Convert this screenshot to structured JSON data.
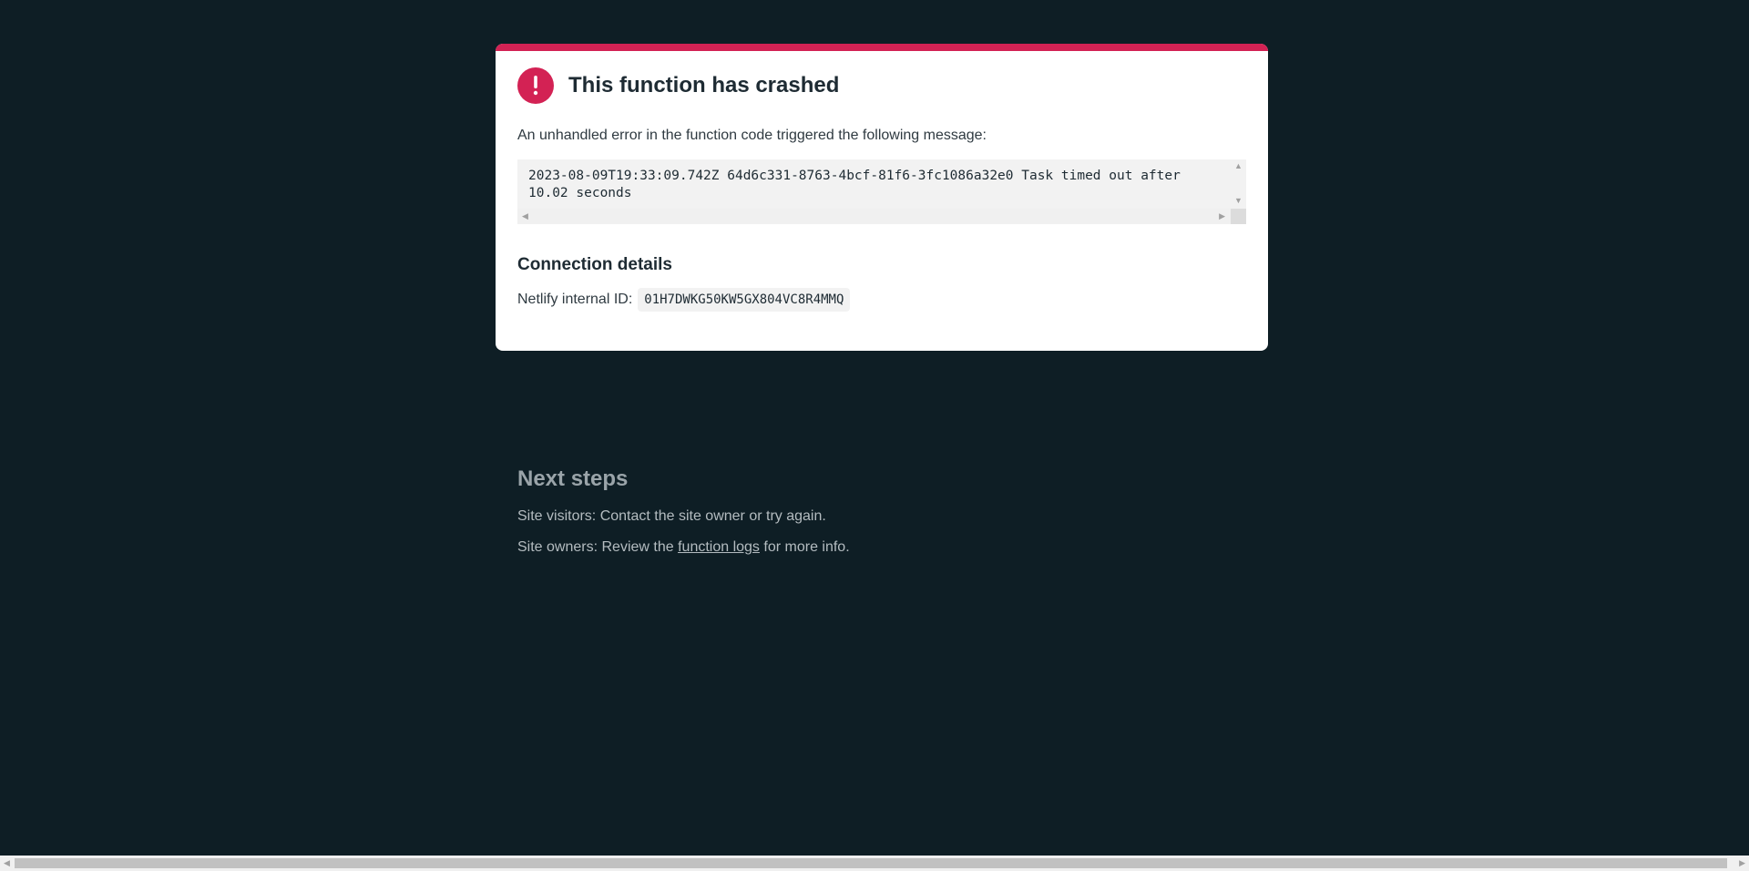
{
  "card": {
    "title": "This function has crashed",
    "lead": "An unhandled error in the function code triggered the following message:",
    "error_message": "2023-08-09T19:33:09.742Z 64d6c331-8763-4bcf-81f6-3fc1086a32e0 Task timed out after\n10.02 seconds",
    "connection_heading": "Connection details",
    "internal_id_label": "Netlify internal ID:",
    "internal_id_value": "01H7DWKG50KW5GX804VC8R4MMQ"
  },
  "next_steps": {
    "heading": "Next steps",
    "visitors_text": "Site visitors: Contact the site owner or try again.",
    "owners_prefix": "Site owners: Review the",
    "owners_link": "function logs",
    "owners_suffix": "for more info."
  },
  "icons": {
    "error": "exclamation-circle-icon"
  },
  "colors": {
    "background": "#0e1e25",
    "accent": "#d32254",
    "card": "#ffffff"
  }
}
